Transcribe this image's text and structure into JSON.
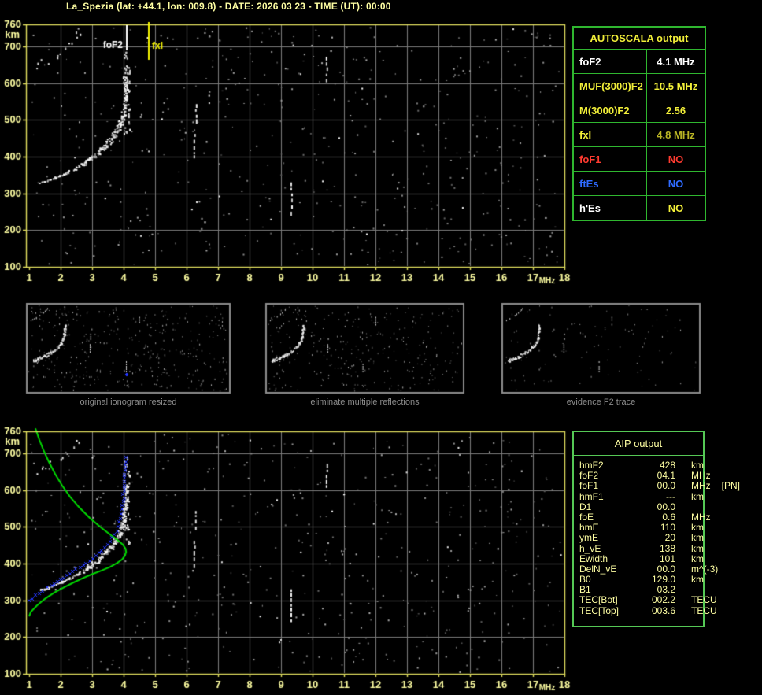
{
  "header": {
    "title": "La_Spezia (lat: +44.1, lon: 009.8) - DATE: 2026 03 23 - TIME (UT): 00:00"
  },
  "autoscala": {
    "title": "AUTOSCALA output",
    "rows": [
      {
        "label": "foF2",
        "value": "4.1 MHz",
        "label_color": "#ffffff",
        "value_color": "#ffffff"
      },
      {
        "label": "MUF(3000)F2",
        "value": "10.5 MHz",
        "label_color": "#f2ef39",
        "value_color": "#f2ef39"
      },
      {
        "label": "M(3000)F2",
        "value": "2.56",
        "label_color": "#f2ef39",
        "value_color": "#f2ef39"
      },
      {
        "label": "fxI",
        "value": "4.8 MHz",
        "label_color": "#f2ef39",
        "value_color": "#b9b425"
      },
      {
        "label": "foF1",
        "value": "NO",
        "label_color": "#ff3b30",
        "value_color": "#ff3b30"
      },
      {
        "label": "ftEs",
        "value": "NO",
        "label_color": "#2f6bff",
        "value_color": "#2f6bff"
      },
      {
        "label": "h'Es",
        "value": "NO",
        "label_color": "#ffffff",
        "value_color": "#f2ef39"
      }
    ]
  },
  "aip": {
    "title": "AIP output",
    "rows": [
      {
        "label": "hmF2",
        "value": "428",
        "unit": "km",
        "extra": ""
      },
      {
        "label": "foF2",
        "value": "04.1",
        "unit": "MHz",
        "extra": ""
      },
      {
        "label": "foF1",
        "value": "00.0",
        "unit": "MHz",
        "extra": "[PN]"
      },
      {
        "label": "hmF1",
        "value": "---",
        "unit": "km",
        "extra": ""
      },
      {
        "label": "D1",
        "value": "00.0",
        "unit": "",
        "extra": ""
      },
      {
        "label": "foE",
        "value": "0.6",
        "unit": "MHz",
        "extra": ""
      },
      {
        "label": "hmE",
        "value": "110",
        "unit": "km",
        "extra": ""
      },
      {
        "label": "ymE",
        "value": "20",
        "unit": "km",
        "extra": ""
      },
      {
        "label": "h_vE",
        "value": "138",
        "unit": "km",
        "extra": ""
      },
      {
        "label": "Ewidth",
        "value": "101",
        "unit": "km",
        "extra": ""
      },
      {
        "label": "DelN_vE",
        "value": "00.0",
        "unit": "m^(-3)",
        "extra": ""
      },
      {
        "label": "B0",
        "value": "129.0",
        "unit": "km",
        "extra": ""
      },
      {
        "label": "B1",
        "value": "03.2",
        "unit": "",
        "extra": ""
      },
      {
        "label": "TEC[Bot]",
        "value": "002.2",
        "unit": "TECU",
        "extra": ""
      },
      {
        "label": "TEC[Top]",
        "value": "003.6",
        "unit": "TECU",
        "extra": ""
      }
    ]
  },
  "thumbnails": {
    "captions": [
      "original ionogram resized",
      "eliminate multiple reflections",
      "evidence F2 trace"
    ]
  },
  "chart_data": {
    "type": "scatter",
    "description": "Ionogram (virtual height km vs frequency MHz) shown twice: raw autoscaled ionogram (top) and with AIP electron-density profile overlay (bottom), plus three processing-step thumbnails.",
    "axes": {
      "x": {
        "min": 1,
        "max": 18,
        "unit": "MHz",
        "ticks": [
          1,
          2,
          3,
          4,
          5,
          6,
          7,
          8,
          9,
          10,
          11,
          12,
          13,
          14,
          15,
          16,
          17,
          18
        ]
      },
      "y": {
        "min": 100,
        "max": 760,
        "unit": "km",
        "ticks": [
          760,
          700,
          600,
          500,
          400,
          300,
          200,
          100
        ]
      },
      "grid": true
    },
    "markers": [
      {
        "label": "foF2",
        "mhz": 4.1,
        "color": "#ffffff"
      },
      {
        "label": "fxI",
        "mhz": 4.8,
        "color": "#f2f200"
      }
    ],
    "f2_trace_mhz_km": [
      [
        1.35,
        327
      ],
      [
        1.5,
        331
      ],
      [
        1.65,
        336
      ],
      [
        1.8,
        341
      ],
      [
        2.0,
        348
      ],
      [
        2.2,
        356
      ],
      [
        2.4,
        364
      ],
      [
        2.6,
        373
      ],
      [
        2.8,
        383
      ],
      [
        3.0,
        394
      ],
      [
        3.2,
        407
      ],
      [
        3.4,
        421
      ],
      [
        3.55,
        434
      ],
      [
        3.7,
        449
      ],
      [
        3.8,
        462
      ],
      [
        3.88,
        476
      ],
      [
        3.94,
        492
      ],
      [
        3.99,
        510
      ],
      [
        4.02,
        528
      ],
      [
        4.045,
        548
      ],
      [
        4.06,
        566
      ],
      [
        4.07,
        584
      ],
      [
        4.08,
        600
      ]
    ],
    "f2_cluster": {
      "mhz": [
        3.97,
        4.18
      ],
      "km": [
        455,
        655
      ],
      "sparse_top_km": [
        640,
        690
      ]
    },
    "second_hop_mhz_km": [
      [
        1.2,
        650
      ],
      [
        1.35,
        656
      ],
      [
        1.5,
        663
      ],
      [
        1.65,
        670
      ],
      [
        1.8,
        678
      ],
      [
        1.95,
        687
      ],
      [
        2.1,
        697
      ],
      [
        2.25,
        708
      ],
      [
        2.4,
        720
      ],
      [
        2.5,
        730
      ],
      [
        2.6,
        740
      ]
    ],
    "echo_streaks_mhz_km": [
      [
        6.22,
        392,
        462
      ],
      [
        6.27,
        498,
        543
      ],
      [
        9.3,
        242,
        330
      ],
      [
        10.42,
        600,
        672
      ]
    ],
    "profile_curve_mhz_km": [
      [
        1.2,
        768
      ],
      [
        1.32,
        738
      ],
      [
        1.45,
        710
      ],
      [
        1.62,
        678
      ],
      [
        1.82,
        645
      ],
      [
        2.05,
        612
      ],
      [
        2.3,
        582
      ],
      [
        2.6,
        552
      ],
      [
        2.95,
        522
      ],
      [
        3.3,
        497
      ],
      [
        3.6,
        477
      ],
      [
        3.82,
        463
      ],
      [
        3.97,
        452
      ],
      [
        4.06,
        441
      ],
      [
        4.08,
        432
      ],
      [
        4.04,
        421
      ],
      [
        3.95,
        411
      ],
      [
        3.8,
        402
      ],
      [
        3.58,
        391
      ],
      [
        3.3,
        381
      ],
      [
        3.0,
        371
      ],
      [
        2.7,
        360
      ],
      [
        2.4,
        348
      ],
      [
        2.1,
        335
      ],
      [
        1.8,
        321
      ],
      [
        1.5,
        304
      ],
      [
        1.25,
        286
      ],
      [
        1.05,
        268
      ],
      [
        1.0,
        256
      ]
    ],
    "restored_trace_mhz_km": [
      [
        1.02,
        300
      ],
      [
        1.2,
        312
      ],
      [
        1.45,
        327
      ],
      [
        1.7,
        341
      ],
      [
        2.0,
        356
      ],
      [
        2.3,
        372
      ],
      [
        2.6,
        389
      ],
      [
        2.9,
        407
      ],
      [
        3.15,
        423
      ],
      [
        3.4,
        442
      ],
      [
        3.58,
        460
      ],
      [
        3.72,
        478
      ],
      [
        3.83,
        500
      ],
      [
        3.9,
        524
      ],
      [
        3.95,
        550
      ],
      [
        3.99,
        577
      ],
      [
        4.02,
        605
      ],
      [
        4.04,
        633
      ],
      [
        4.05,
        660
      ],
      [
        4.06,
        688
      ],
      [
        4.06,
        702
      ]
    ],
    "thumb_blue_marker_mhz_km": [
      9.3,
      232
    ],
    "noise_seed": 1234567
  },
  "colors": {
    "background": "#000000",
    "pale_yellow": "#fdfda2",
    "bright_yellow": "#f2ef39",
    "plot_border": "#e3e060",
    "grid": "#7d7d7d",
    "trace_white": "#ffffff",
    "green_curve": "#00d800",
    "blue_trace": "#2437ff",
    "table_border_autoscala": "#2fb62f",
    "table_border_aip": "#55c855",
    "thumb_border": "#8c8c8c",
    "caption_gray": "#8c8c8c",
    "status_red": "#ff3b30",
    "status_blue": "#2f6bff"
  }
}
